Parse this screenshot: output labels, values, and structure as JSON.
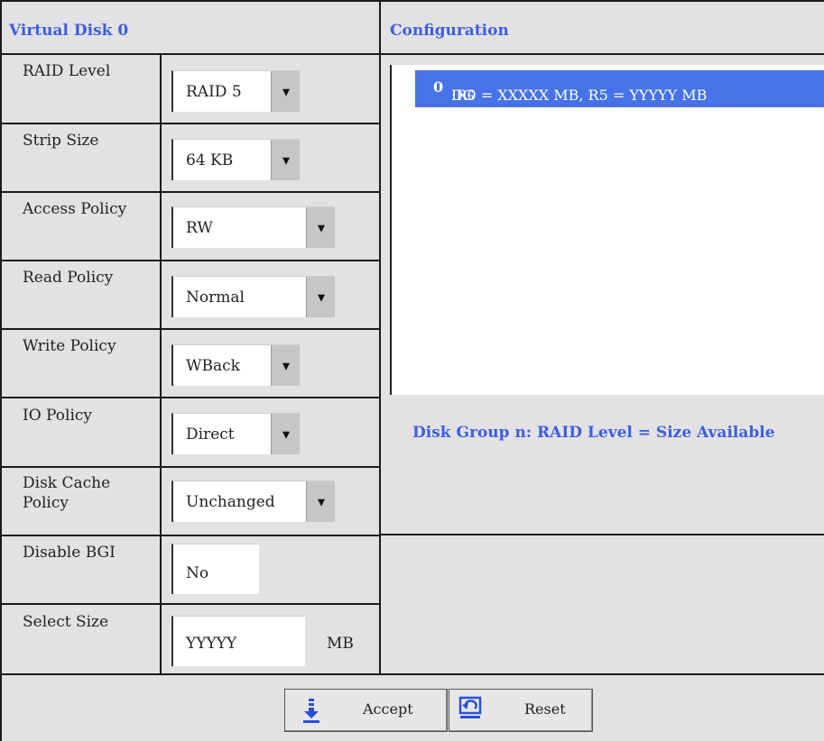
{
  "left_panel": {
    "title": "Virtual Disk 0",
    "rows": [
      {
        "label": "RAID Level",
        "value": "RAID 5",
        "type": "dropdown"
      },
      {
        "label": "Strip Size",
        "value": "64 KB",
        "type": "dropdown"
      },
      {
        "label": "Access Policy",
        "value": "RW",
        "type": "dropdown"
      },
      {
        "label": "Read Policy",
        "value": "Normal",
        "type": "dropdown"
      },
      {
        "label": "Write Policy",
        "value": "WBack",
        "type": "dropdown"
      },
      {
        "label": "IO Policy",
        "value": "Direct",
        "type": "dropdown"
      },
      {
        "label_line1": "Disk Cache",
        "label_line2": "Policy",
        "value": "Unchanged",
        "type": "dropdown"
      },
      {
        "label": "Disable BGI",
        "value": "No",
        "type": "text"
      },
      {
        "label": "Select Size",
        "value": "YYYYY",
        "unit": "MB",
        "type": "text"
      }
    ]
  },
  "right_panel": {
    "title": "Configuration",
    "list_items": [
      {
        "prefix": "DG ",
        "bold": "0",
        "rest": " :R0 = XXXXX MB, R5 = YYYYY MB",
        "selected": true
      }
    ],
    "availability_text": "Disk Group n: RAID Level = Size Available"
  },
  "footer": {
    "accept_label": "Accept",
    "reset_label": "Reset"
  },
  "colors": {
    "accent": "#3c5fe0",
    "selection": "#4673e8",
    "panel_bg": "#e3e1e4"
  },
  "icons": {
    "accept": "download-arrow-icon",
    "reset": "undo-arrow-icon"
  }
}
